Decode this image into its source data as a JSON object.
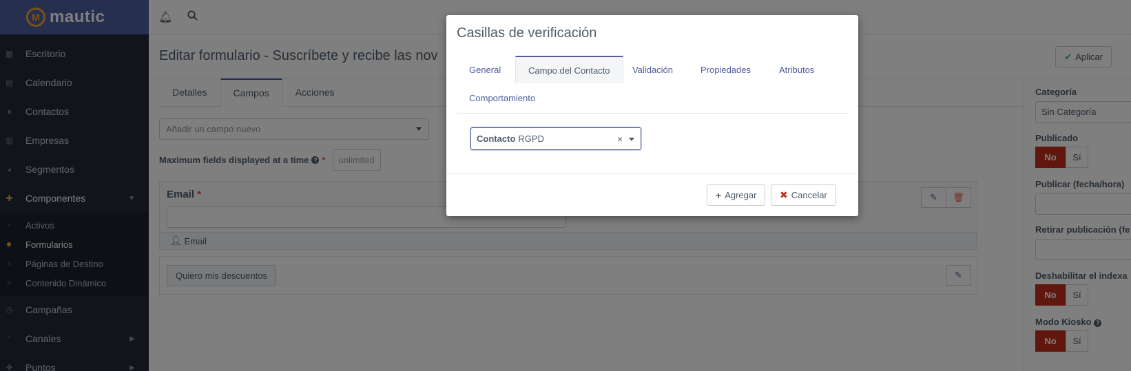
{
  "brand": {
    "name": "mautic",
    "mark": "M"
  },
  "sidebar": {
    "items": [
      {
        "label": "Escritorio",
        "icon": "dashboard-icon"
      },
      {
        "label": "Calendario",
        "icon": "calendar-icon"
      },
      {
        "label": "Contactos",
        "icon": "user-icon"
      },
      {
        "label": "Empresas",
        "icon": "building-icon"
      },
      {
        "label": "Segmentos",
        "icon": "pie-chart-icon"
      },
      {
        "label": "Componentes",
        "icon": "puzzle-icon"
      }
    ],
    "subitems": [
      {
        "label": "Activos"
      },
      {
        "label": "Formularios"
      },
      {
        "label": "Páginas de Destino"
      },
      {
        "label": "Contenido Dinámico"
      }
    ],
    "more_items": [
      {
        "label": "Campañas",
        "icon": "clock-icon"
      },
      {
        "label": "Canales",
        "icon": "rss-icon"
      },
      {
        "label": "Puntos",
        "icon": "puzzle-icon"
      }
    ]
  },
  "header": {
    "title": "Editar formulario - Suscríbete y recibe las nov",
    "apply_label": "Aplicar"
  },
  "main": {
    "tabs": [
      {
        "label": "Detalles"
      },
      {
        "label": "Campos"
      },
      {
        "label": "Acciones"
      }
    ],
    "add_field_placeholder": "Añadir un campo nuevo",
    "max_fields_label": "Maximum fields displayed at a time",
    "max_fields_value": "unlimited",
    "field": {
      "label": "Email",
      "footer_label": "Email"
    },
    "button_label": "Quiero mis descuentos"
  },
  "right": {
    "category_label": "Categoría",
    "category_value": "Sin Categoría",
    "published_label": "Publicado",
    "publish_at_label": "Publicar (fecha/hora)",
    "unpublish_label": "Retirar publicación (fe",
    "noindex_label": "Deshabilitar el indexa",
    "kiosk_label": "Modo Kiosko",
    "no": "No",
    "yes": "Sí"
  },
  "modal": {
    "title": "Casillas de verificación",
    "tabs": [
      {
        "label": "General"
      },
      {
        "label": "Campo del Contacto"
      },
      {
        "label": "Validación"
      },
      {
        "label": "Propiedades"
      },
      {
        "label": "Atributos"
      },
      {
        "label": "Comportamiento"
      }
    ],
    "select_group": "Contacto",
    "select_value": "RGPD",
    "add_label": "Agregar",
    "cancel_label": "Cancelar"
  },
  "colors": {
    "sidebar_bg": "#222b36",
    "brand_bg": "#4e5e9e",
    "accent": "#f2a23b",
    "danger": "#c12f1c"
  }
}
